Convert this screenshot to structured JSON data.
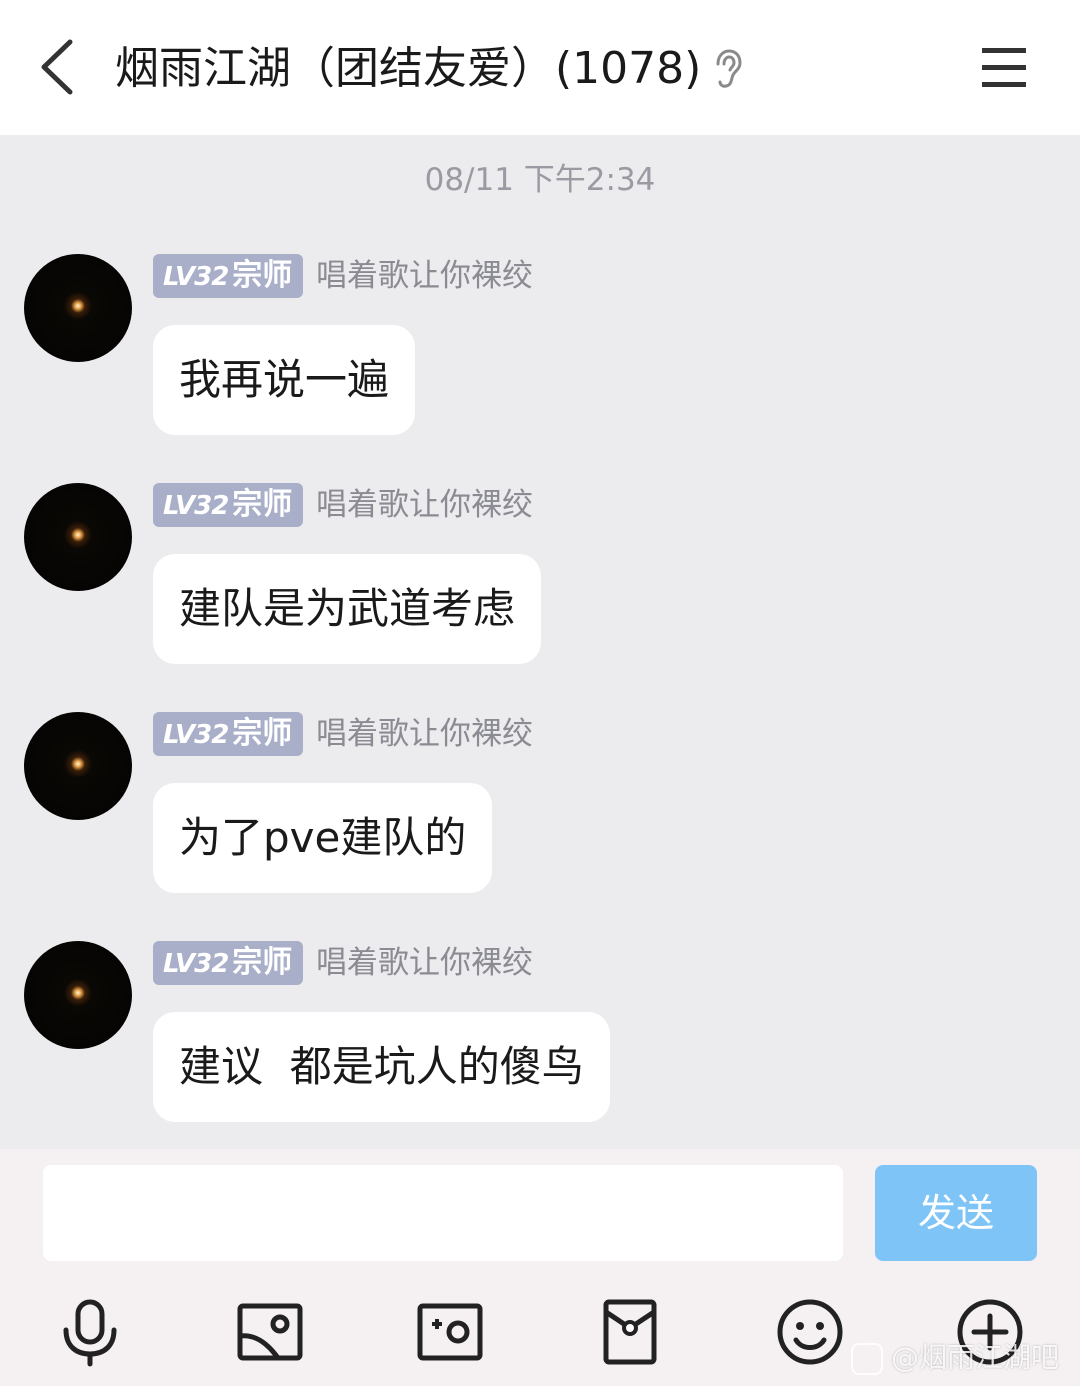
{
  "header": {
    "title": "烟雨江湖（团结友爱）(1078)",
    "back_icon": "chevron-left-icon",
    "ear_icon": "ear-icon",
    "menu_icon": "hamburger-menu-icon"
  },
  "timestamp": "08/11 下午2:34",
  "messages": [
    {
      "level": "LV32",
      "rank": "宗师",
      "nickname": "唱着歌让你裸绞",
      "text": "我再说一遍"
    },
    {
      "level": "LV32",
      "rank": "宗师",
      "nickname": "唱着歌让你裸绞",
      "text": "建队是为武道考虑"
    },
    {
      "level": "LV32",
      "rank": "宗师",
      "nickname": "唱着歌让你裸绞",
      "text": "为了pve建队的"
    },
    {
      "level": "LV32",
      "rank": "宗师",
      "nickname": "唱着歌让你裸绞",
      "text": "建议  都是坑人的傻鸟"
    }
  ],
  "composer": {
    "input_value": "",
    "send_label": "发送"
  },
  "toolbar": {
    "icons": [
      "microphone-icon",
      "image-icon",
      "camera-icon",
      "red-packet-icon",
      "emoji-icon",
      "plus-icon"
    ]
  },
  "watermark": "@烟雨江湖吧",
  "colors": {
    "background": "#ececee",
    "badge": "#a9afc9",
    "send_button": "#7fc4f7",
    "composer": "#f5f0f2"
  }
}
